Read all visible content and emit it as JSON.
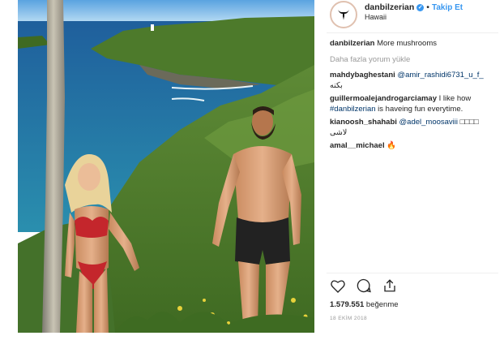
{
  "post": {
    "username": "danbilzerian",
    "follow_label": "Takip Et",
    "location": "Hawaii",
    "caption_user": "danbilzerian",
    "caption_text": "More mushrooms",
    "load_more": "Daha fazla yorum yükle",
    "comments": [
      {
        "user": "mahdybaghestani",
        "mention": "@amir_rashidi6731_u_f_",
        "text": "بکنه"
      },
      {
        "user": "guillermoalejandrogarciamay",
        "text_before": "I like how",
        "mention": "#danbilzerian",
        "text_after": "is haveing fun everytime."
      },
      {
        "user": "kianoosh_shahabi",
        "mention": "@adel_moosaviii",
        "text": "□□□□",
        "text2": "لاشی"
      },
      {
        "user": "amal__michael",
        "text": "🔥"
      }
    ],
    "likes_count": "1.579.551",
    "likes_label": "beğenme",
    "date": "18 EKİM 2018"
  },
  "icons": {
    "like": "heart-icon",
    "comment": "comment-icon",
    "share": "share-icon",
    "verified": "verified-badge-icon",
    "avatar": "bull-logo-icon"
  },
  "colors": {
    "link": "#3897f0",
    "mention": "#003569",
    "muted": "#999999"
  }
}
